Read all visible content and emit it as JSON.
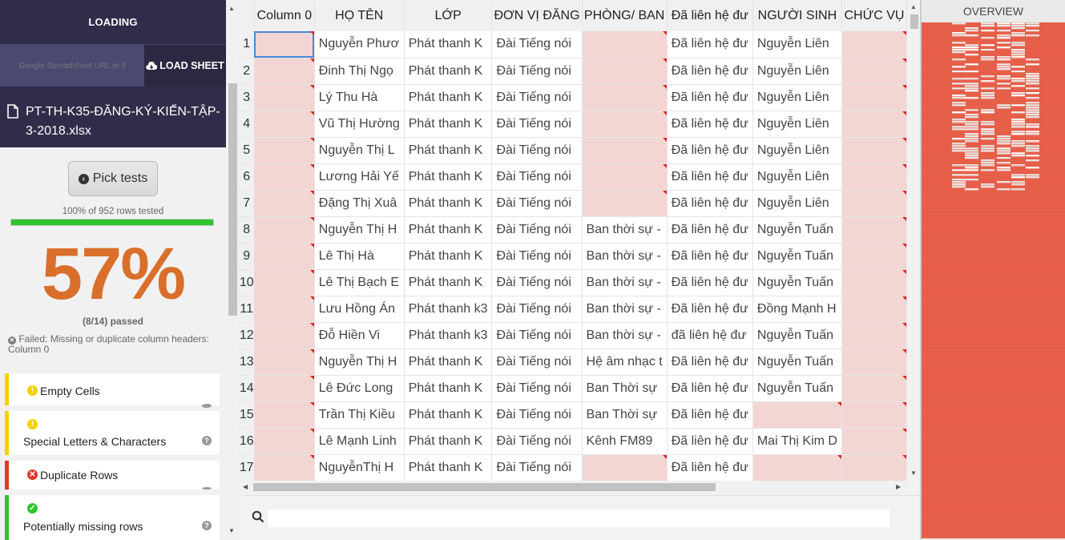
{
  "sidebar": {
    "loading_label": "LOADING",
    "url_placeholder": "Google Spreadsheet URL or ll",
    "load_sheet_label": "LOAD SHEET",
    "file_name": "PT-TH-K35-ĐĂNG-KÝ-KIẾN-TẬP-3-2018.xlsx",
    "pick_tests_label": "Pick tests",
    "rows_tested": "100% of 952 rows tested",
    "progress_fraction": 1.0,
    "score": "57%",
    "passed": "(8/14) passed",
    "fail_message": "Failed: Missing or duplicate column headers: Column 0",
    "tests": [
      {
        "label": "Empty Cells",
        "status": "warning"
      },
      {
        "label": "Special Letters & Characters",
        "status": "warning"
      },
      {
        "label": "Duplicate Rows",
        "status": "error"
      },
      {
        "label": "Potentially missing rows",
        "status": "ok"
      }
    ]
  },
  "grid": {
    "columns": [
      "Column 0",
      "HỌ TÊN",
      "LỚP",
      "ĐƠN VỊ ĐĂNG",
      "PHÒNG/ BAN",
      "Đã liên hệ đư",
      "NGƯỜI SINH",
      "CHỨC VỤ"
    ],
    "rows": [
      {
        "n": "1",
        "cells": [
          "",
          "Nguyễn Phươ",
          "Phát thanh K",
          "Đài Tiếng nói",
          "",
          "Đã liên hệ đư",
          "Nguyễn Liên",
          ""
        ],
        "err": [
          0,
          4,
          7
        ]
      },
      {
        "n": "2",
        "cells": [
          "",
          "Đinh Thị Ngọ",
          "Phát thanh K",
          "Đài Tiếng nói",
          "",
          "Đã liên hệ đư",
          "Nguyễn Liên",
          ""
        ],
        "err": [
          0,
          4,
          7
        ]
      },
      {
        "n": "3",
        "cells": [
          "",
          "Lý Thu Hà",
          "Phát thanh K",
          "Đài Tiếng nói",
          "",
          "Đã liên hệ đư",
          "Nguyễn Liên",
          ""
        ],
        "err": [
          0,
          4,
          7
        ]
      },
      {
        "n": "4",
        "cells": [
          "",
          "Vũ Thị Hường",
          "Phát thanh K",
          "Đài Tiếng nói",
          "",
          "Đã liên hệ đư",
          "Nguyễn Liên",
          ""
        ],
        "err": [
          0,
          4,
          7
        ]
      },
      {
        "n": "5",
        "cells": [
          "",
          "Nguyễn Thị L",
          "Phát thanh K",
          "Đài Tiếng nói",
          "",
          "Đã liên hệ đư",
          "Nguyễn Liên",
          ""
        ],
        "err": [
          0,
          4,
          7
        ]
      },
      {
        "n": "6",
        "cells": [
          "",
          "Lương Hải Yế",
          "Phát thanh K",
          "Đài Tiếng nói",
          "",
          "Đã liên hệ đư",
          "Nguyễn Liên",
          ""
        ],
        "err": [
          0,
          4,
          7
        ]
      },
      {
        "n": "7",
        "cells": [
          "",
          "Đặng Thị Xuâ",
          "Phát thanh K",
          "Đài Tiếng nói",
          "",
          "Đã liên hệ đư",
          "Nguyễn Liên",
          ""
        ],
        "err": [
          0,
          4,
          7
        ]
      },
      {
        "n": "8",
        "cells": [
          "",
          "Nguyễn Thị H",
          "Phát thanh K",
          "Đài Tiếng nói",
          "Ban thời sự -",
          "Đã liên hệ đư",
          "Nguyễn Tuấn",
          ""
        ],
        "err": [
          0,
          7
        ]
      },
      {
        "n": "9",
        "cells": [
          "",
          "Lê Thị Hà",
          "Phát thanh K",
          "Đài Tiếng nói",
          "Ban thời sự -",
          "Đã liên hệ đư",
          "Nguyễn Tuấn",
          ""
        ],
        "err": [
          0,
          7
        ]
      },
      {
        "n": "10",
        "cells": [
          "",
          "Lê Thị Bạch E",
          "Phát thanh K",
          "Đài Tiếng nói",
          "Ban thời sự -",
          "Đã liên hệ đư",
          "Nguyễn Tuấn",
          ""
        ],
        "err": [
          0,
          7
        ]
      },
      {
        "n": "11",
        "cells": [
          "",
          "Lưu Hồng Án",
          "Phát thanh k3",
          "Đài Tiếng nói",
          "Ban thời sự -",
          "Đã liên hệ đư",
          "Đồng Mạnh H",
          ""
        ],
        "err": [
          0,
          7
        ]
      },
      {
        "n": "12",
        "cells": [
          "",
          "Đỗ Hiền Vi",
          "Phát thanh k3",
          "Đài Tiếng nói",
          "Ban thời sự -",
          "đã liên hệ đư",
          "Nguyễn Tuấn",
          ""
        ],
        "err": [
          0,
          7
        ]
      },
      {
        "n": "13",
        "cells": [
          "",
          "Nguyễn Thị H",
          "Phát thanh K",
          "Đài Tiếng nói",
          "Hệ âm nhạc t",
          "Đã liên hệ đư",
          "Nguyễn Tuấn",
          ""
        ],
        "err": [
          0,
          7
        ]
      },
      {
        "n": "14",
        "cells": [
          "",
          "Lê Đức Long",
          "Phát thanh K",
          "Đài Tiếng nói",
          "Ban Thời sự",
          "Đã liên hệ đư",
          "Nguyễn Tuấn",
          ""
        ],
        "err": [
          0,
          7
        ]
      },
      {
        "n": "15",
        "cells": [
          "",
          "Trần Thị Kiều",
          "Phát thanh K",
          "Đài Tiếng nói",
          "Ban Thời sự",
          "Đã liên hệ đư",
          "",
          ""
        ],
        "err": [
          0,
          6,
          7
        ]
      },
      {
        "n": "16",
        "cells": [
          "",
          "Lê Mạnh Linh",
          "Phát thanh K",
          "Đài Tiếng nói",
          "Kênh FM89",
          "Đã liên hệ đư",
          "Mai Thị Kim D",
          ""
        ],
        "err": [
          0,
          7
        ]
      },
      {
        "n": "17",
        "cells": [
          "",
          "NguyễnThị H",
          "Phát thanh K",
          "Đài Tiếng nói",
          "",
          "Đã liên hệ đư",
          "",
          ""
        ],
        "err": [
          0,
          4,
          6,
          7
        ]
      }
    ]
  },
  "search": {
    "placeholder": ""
  },
  "overview": {
    "title": "OVERVIEW"
  },
  "colors": {
    "error_cell": "#f3d6d3",
    "score": "#d96f2a",
    "overview_error": "#e8604a",
    "overview_ok": "#e8e8e8"
  }
}
